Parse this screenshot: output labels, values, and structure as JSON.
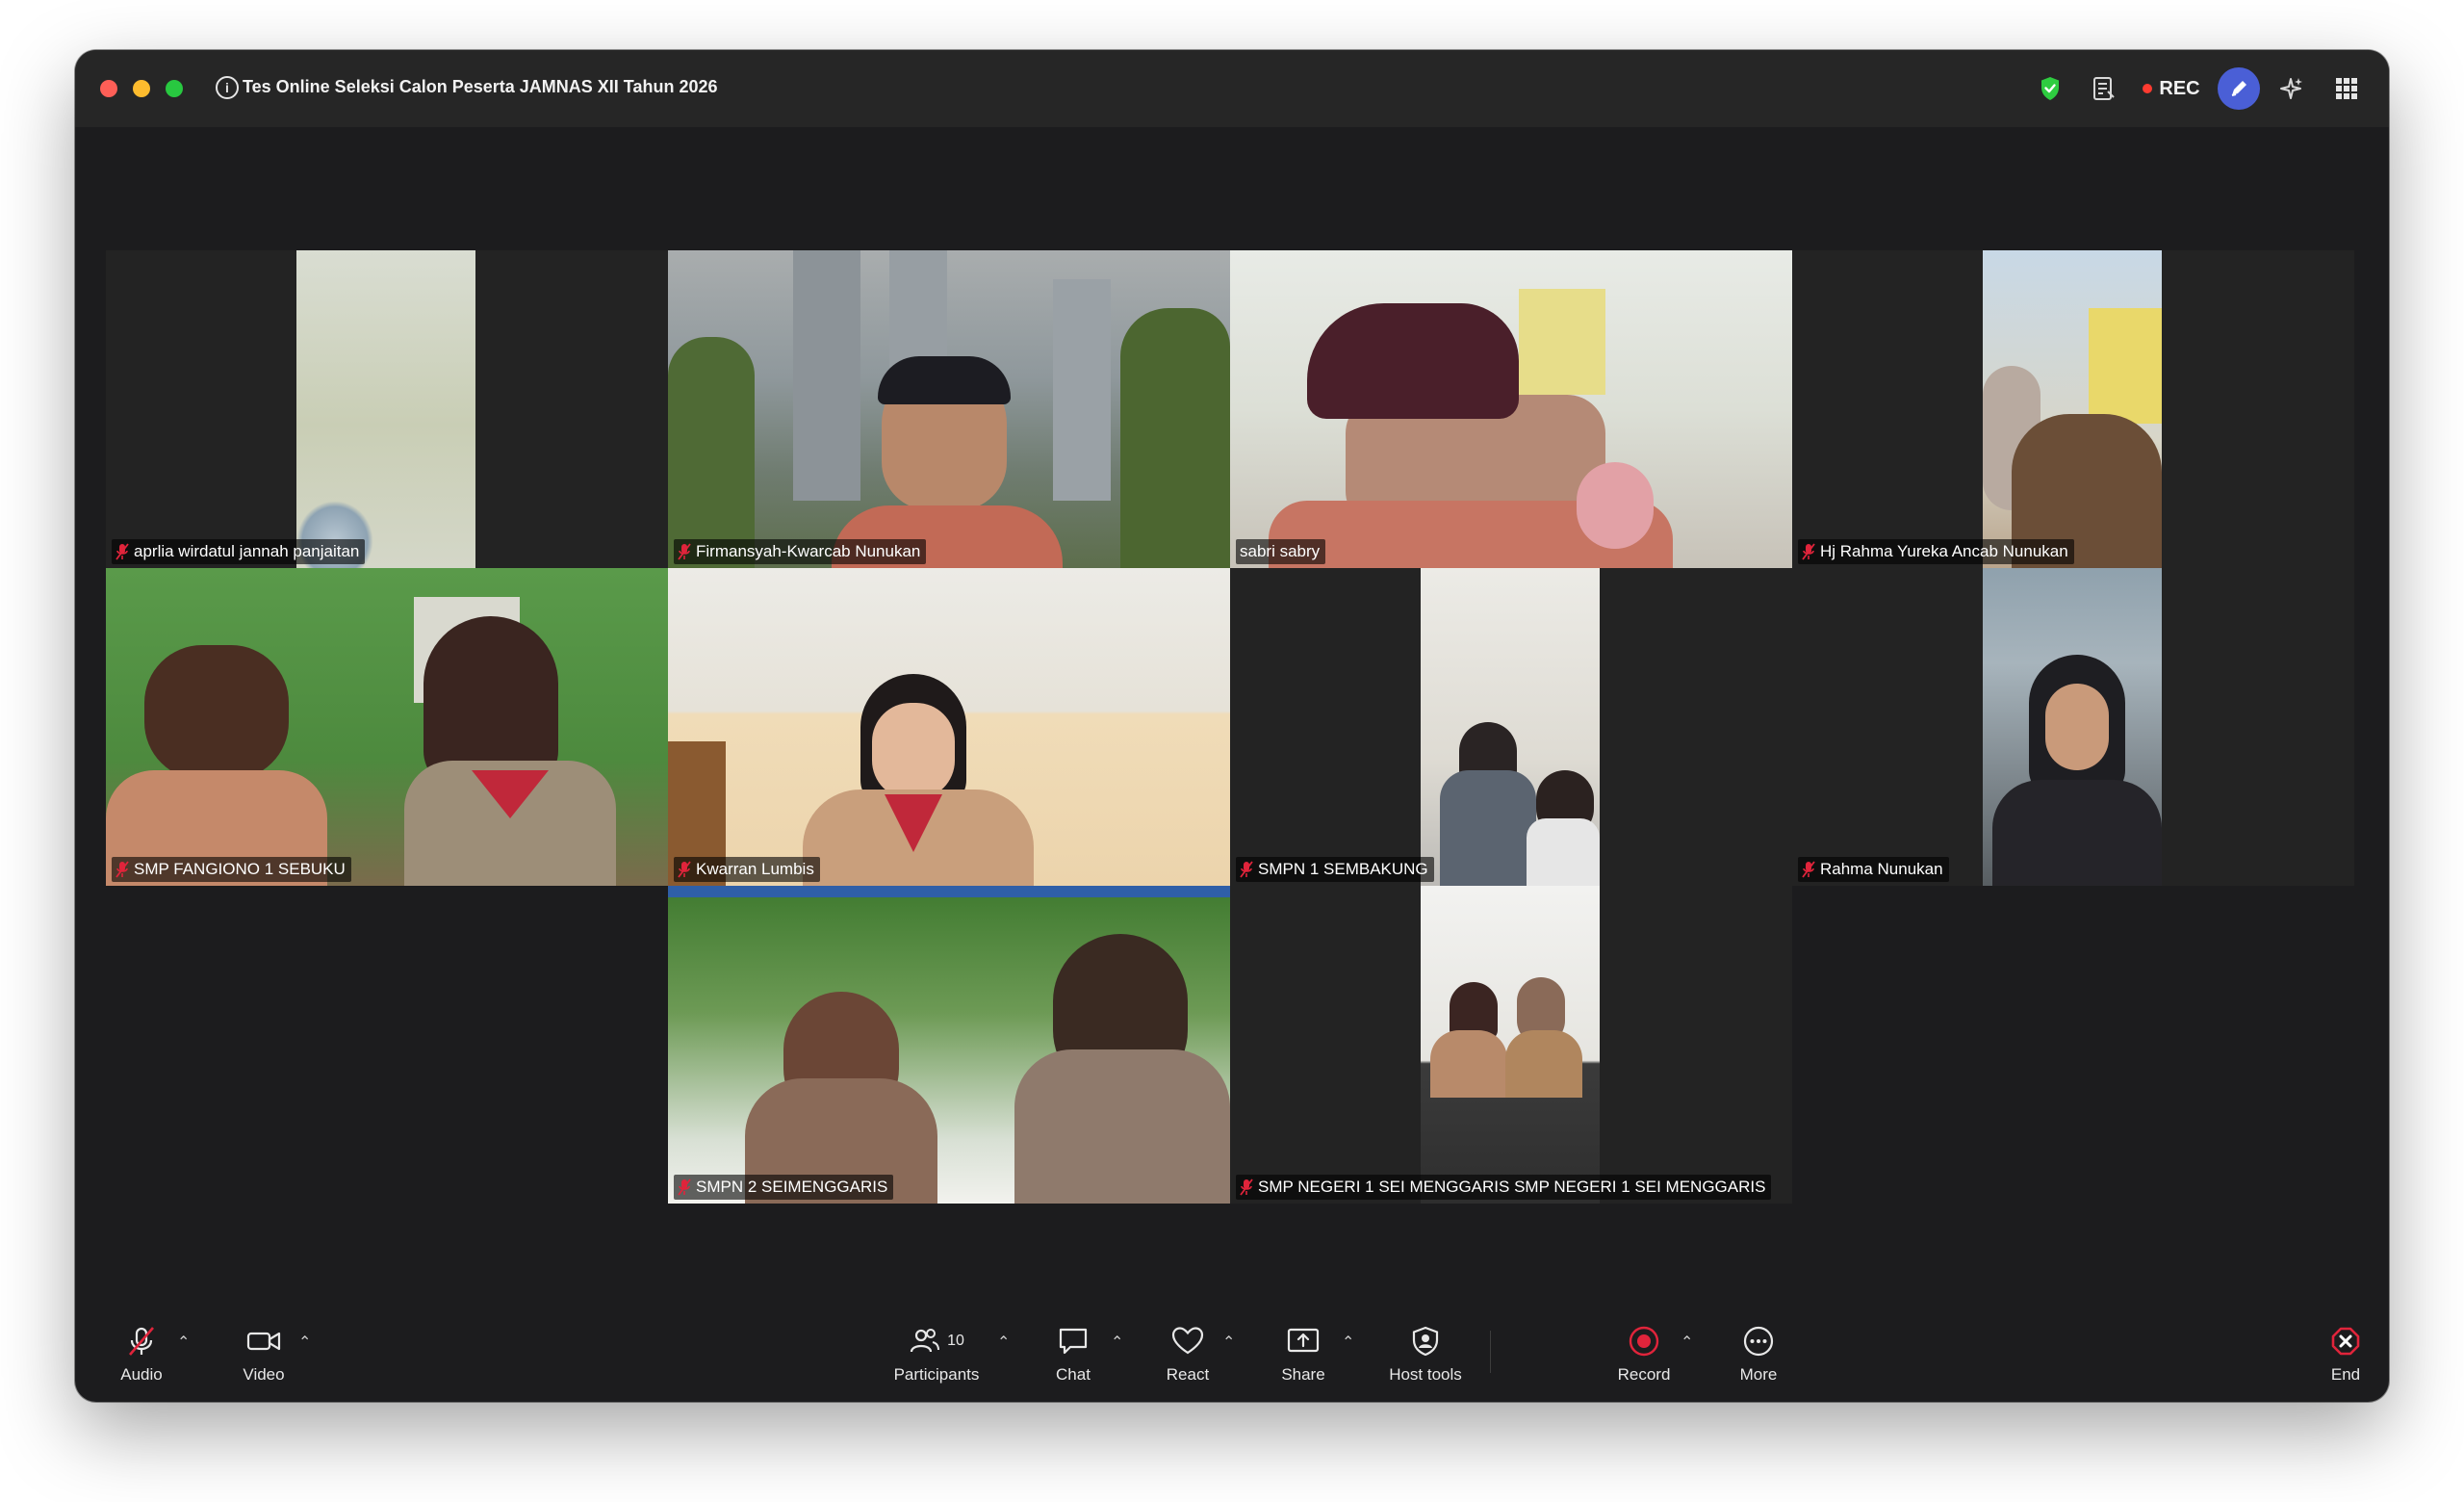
{
  "window": {
    "title": "Tes Online Seleksi Calon Peserta JAMNAS XII Tahun 2026",
    "recording_label": "REC"
  },
  "colors": {
    "accent_red": "#e0243b",
    "shield_green": "#2ecc40",
    "avatar_blue": "#4a5fd6"
  },
  "participants": [
    {
      "name": "aprlia wirdatul jannah panjaitan",
      "muted": true
    },
    {
      "name": "Firmansyah-Kwarcab Nunukan",
      "muted": true
    },
    {
      "name": "sabri sabry",
      "muted": false
    },
    {
      "name": "Hj Rahma Yureka Ancab Nunukan",
      "muted": true
    },
    {
      "name": "SMP FANGIONO 1 SEBUKU",
      "muted": true
    },
    {
      "name": "Kwarran Lumbis",
      "muted": true
    },
    {
      "name": "SMPN 1 SEMBAKUNG",
      "muted": true
    },
    {
      "name": "Rahma Nunukan",
      "muted": true
    },
    {
      "name": "SMPN 2 SEIMENGGARIS",
      "muted": true
    },
    {
      "name": "SMP NEGERI 1 SEI MENGGARIS SMP NEGERI 1 SEI MENGGARIS",
      "muted": true
    }
  ],
  "toolbar": {
    "audio": "Audio",
    "video": "Video",
    "participants": "Participants",
    "participants_count": "10",
    "chat": "Chat",
    "react": "React",
    "share": "Share",
    "host_tools": "Host tools",
    "record": "Record",
    "more": "More",
    "end": "End"
  }
}
